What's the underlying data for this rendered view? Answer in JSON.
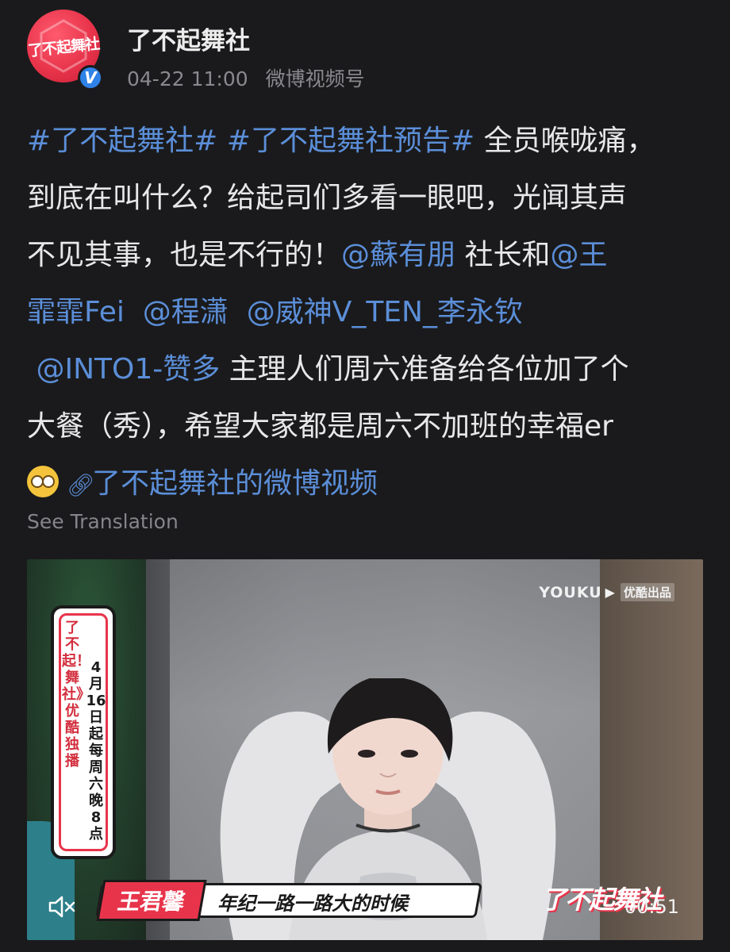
{
  "header": {
    "avatar_text": "了不起舞社",
    "verified_mark": "V",
    "username": "了不起舞社",
    "timestamp": "04-22 11:00",
    "source": "微博视频号"
  },
  "post": {
    "hashtag1": "#了不起舞社#",
    "hashtag2": "#了不起舞社预告#",
    "line1_text": " 全员喉咙痛，",
    "line2_text": "到底在叫什么？给起司们多看一眼吧，光闻其声",
    "line3_text": "不见其事，也是不行的！",
    "mention1": "@蘇有朋",
    "line3_text2": " 社长和",
    "mention2a": "@王",
    "mention2b": "霏霏Fei",
    "mention3": "@程潇",
    "mention4": "@威神V_TEN_李永钦",
    "mention5": "@INTO1-赞多",
    "line5_text": " 主理人们周六准备给各位加了个",
    "line6_text": "大餐（秀），希望大家都是周六不加班的幸福er",
    "video_link": "了不起舞社的微博视频"
  },
  "see_translation": "See Translation",
  "video": {
    "banner_col1": "了不起！舞社》优酷独播",
    "banner_col2": "4月16日起每周六晚8点",
    "youku_brand": "YOUKU",
    "youku_tag": "优酷出品",
    "caption_name": "王君馨",
    "caption_text": "年纪一路一路大的时候",
    "logo": "了不起舞社",
    "time": "00:51"
  },
  "colors": {
    "background": "#1a1a1c",
    "link": "#5b8ed8",
    "brand_red": "#e8344b",
    "verified_blue": "#2f82e6"
  },
  "icons": [
    "verified-badge-icon",
    "emoji-icon",
    "link-chain-icon",
    "mute-icon"
  ]
}
